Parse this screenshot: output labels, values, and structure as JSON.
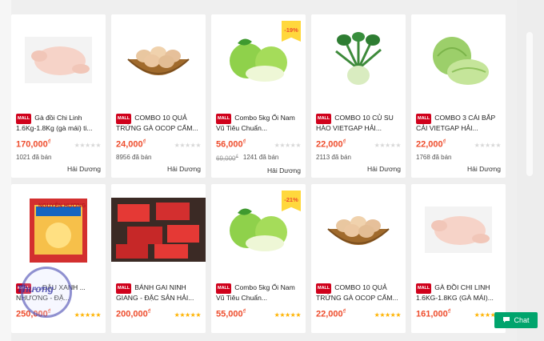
{
  "products_row1": [
    {
      "title": "Gà đồi Chi Linh 1.6Kg-1.8Kg (gà mái) ti...",
      "price": "170,000",
      "sold": "1021 đã bán",
      "location": "Hải Dương",
      "rating": 0,
      "icon": "whole-chicken"
    },
    {
      "title": "COMBO 10 QUẢ TRỨNG GÀ OCOP CẨM...",
      "price": "24,000",
      "sold": "8956 đã bán",
      "location": "Hải Dương",
      "rating": 0,
      "icon": "egg-basket"
    },
    {
      "title": "Combo 5kg Ổi Nam Vũ Tiêu Chuẩn...",
      "price": "56,000",
      "old_price": "69,000",
      "sold": "1241 đã bán",
      "location": "Hải Dương",
      "rating": 0,
      "discount": "-19%",
      "icon": "guava"
    },
    {
      "title": "COMBO 10 CỦ SU HÀO VIETGAP HẢI...",
      "price": "22,000",
      "sold": "2113 đã bán",
      "location": "Hải Dương",
      "rating": 0,
      "icon": "kohlrabi"
    },
    {
      "title": "COMBO 3 CÁI BẮP CẢI VIETGAP HẢI...",
      "price": "22,000",
      "sold": "1768 đã bán",
      "location": "Hải Dương",
      "rating": 0,
      "icon": "cabbage"
    }
  ],
  "products_row2": [
    {
      "title": "... ĐẬU XANH ... NHƯƠNG - ĐẶ...",
      "price": "250,000",
      "rating": 5,
      "brand": "NGUYÊN HƯƠNG",
      "icon": "gift-box"
    },
    {
      "title": "BÁNH GAI NINH GIANG - ĐẶC SẢN HẢI...",
      "price": "200,000",
      "rating": 5,
      "icon": "cake-packs"
    },
    {
      "title": "Combo 5kg Ổi Nam Vũ Tiêu Chuẩn...",
      "price": "55,000",
      "rating": 5,
      "discount": "-21%",
      "icon": "guava"
    },
    {
      "title": "COMBO 10 QUẢ TRỨNG GÀ OCOP CẨM...",
      "price": "22,000",
      "rating": 5,
      "icon": "egg-basket"
    },
    {
      "title": "GÀ ĐỒI CHI LINH 1.6KG-1.8KG (GÀ MÁI)...",
      "price": "161,000",
      "rating": 5,
      "icon": "whole-chicken"
    }
  ],
  "mall_label": "MALL",
  "currency": "₫",
  "chat_label": "Chat",
  "watermark_text": "Thương",
  "colors": {
    "price": "#ee4d2d",
    "mall": "#d0011b",
    "chat": "#00a46c",
    "discount": "#ffd83d"
  }
}
